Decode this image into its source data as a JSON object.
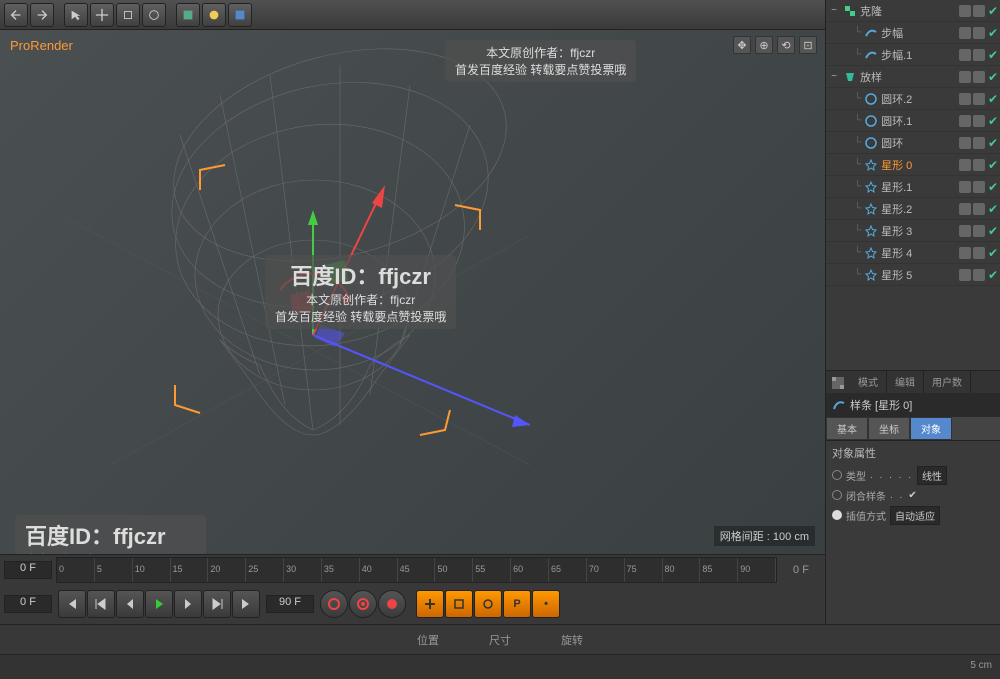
{
  "viewport": {
    "renderer": "ProRender",
    "grid_info": "网格间距 : 100 cm"
  },
  "watermarks": {
    "id_label": "百度ID：ffjczr",
    "author": "本文原创作者：ffjczr",
    "source": "首发百度经验 转载要点赞投票哦"
  },
  "objects": [
    {
      "indent": 0,
      "exp": "−",
      "icon": "cloner",
      "name": "克隆",
      "selected": false
    },
    {
      "indent": 1,
      "exp": "",
      "icon": "spline-blue",
      "name": "步幅",
      "selected": false
    },
    {
      "indent": 1,
      "exp": "",
      "icon": "spline-blue",
      "name": "步幅.1",
      "selected": false
    },
    {
      "indent": 0,
      "exp": "−",
      "icon": "loft",
      "name": "放样",
      "selected": false
    },
    {
      "indent": 1,
      "exp": "",
      "icon": "circle",
      "name": "圆环.2",
      "selected": false
    },
    {
      "indent": 1,
      "exp": "",
      "icon": "circle",
      "name": "圆环.1",
      "selected": false
    },
    {
      "indent": 1,
      "exp": "",
      "icon": "circle",
      "name": "圆环",
      "selected": false
    },
    {
      "indent": 1,
      "exp": "",
      "icon": "star",
      "name": "星形 0",
      "selected": true
    },
    {
      "indent": 1,
      "exp": "",
      "icon": "star",
      "name": "星形.1",
      "selected": false
    },
    {
      "indent": 1,
      "exp": "",
      "icon": "star",
      "name": "星形.2",
      "selected": false
    },
    {
      "indent": 1,
      "exp": "",
      "icon": "star",
      "name": "星形 3",
      "selected": false
    },
    {
      "indent": 1,
      "exp": "",
      "icon": "star",
      "name": "星形 4",
      "selected": false
    },
    {
      "indent": 1,
      "exp": "",
      "icon": "star",
      "name": "星形 5",
      "selected": false
    }
  ],
  "attr_tabs": {
    "mode": "模式",
    "edit": "编辑",
    "user": "用户数"
  },
  "attr_header": "样条 [星形 0]",
  "prop_tabs": {
    "basic": "基本",
    "coord": "坐标",
    "object": "对象"
  },
  "props": {
    "section_title": "对象属性",
    "type_label": "类型",
    "type_value": "线性",
    "close_label": "闭合样条",
    "interp_label": "插值方式",
    "interp_value": "自动适应"
  },
  "timeline": {
    "start": "0 F",
    "end": "0 F",
    "ticks": [
      "0",
      "5",
      "10",
      "15",
      "20",
      "25",
      "30",
      "35",
      "40",
      "45",
      "50",
      "55",
      "60",
      "65",
      "70",
      "75",
      "80",
      "85",
      "90"
    ]
  },
  "playback": {
    "frame": "0 F",
    "frame_b": "90 F"
  },
  "transform": {
    "pos": "位置",
    "size": "尺寸",
    "rot": "旋转"
  },
  "status": {
    "coord": "5 cm"
  }
}
